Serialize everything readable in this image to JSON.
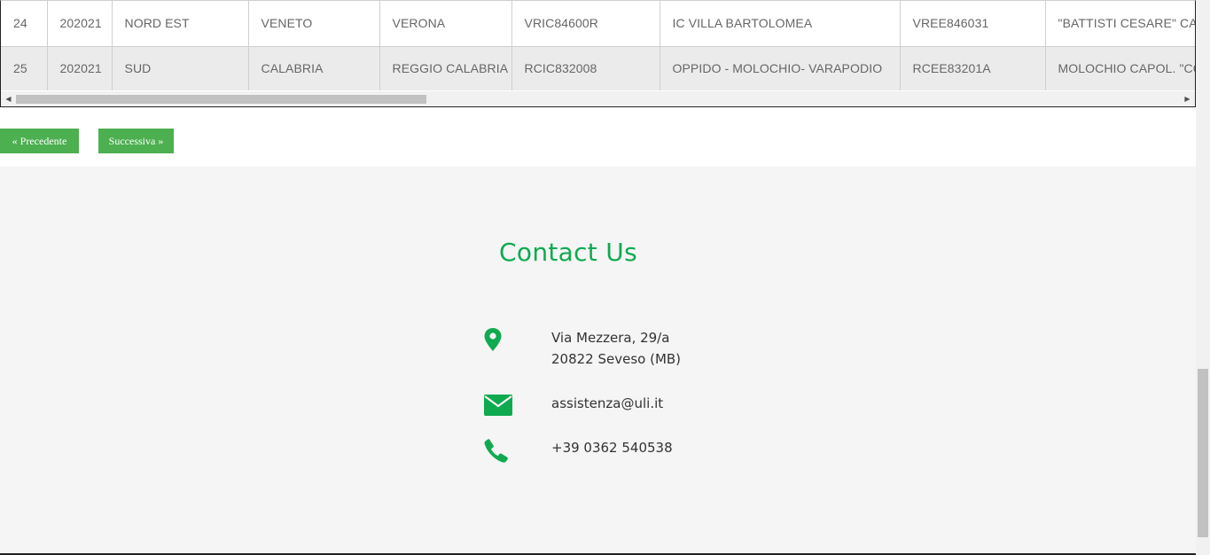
{
  "table": {
    "rows": [
      {
        "id": "24",
        "year": "202021",
        "area": "NORD EST",
        "region": "VENETO",
        "province": "VERONA",
        "school_code": "VRIC84600R",
        "school_name": "IC VILLA BARTOLOMEA",
        "plesso_code": "VREE846031",
        "plesso_name": "\"BATTISTI CESARE\" CAST"
      },
      {
        "id": "25",
        "year": "202021",
        "area": "SUD",
        "region": "CALABRIA",
        "province": "REGGIO CALABRIA",
        "school_code": "RCIC832008",
        "school_name": "OPPIDO - MOLOCHIO- VARAPODIO",
        "plesso_code": "RCEE83201A",
        "plesso_name": "MOLOCHIO CAPOL. \"CO"
      }
    ],
    "scroll_left_arrow": "◀",
    "scroll_right_arrow": "▶"
  },
  "pager": {
    "prev_label": "« Precedente",
    "next_label": "Successiva »"
  },
  "footer": {
    "title": "Contact Us",
    "address_line1": "Via Mezzera, 29/a",
    "address_line2": "20822 Seveso (MB)",
    "email": "assistenza@uli.it",
    "phone": "+39 0362 540538",
    "icons": {
      "address": "map-marker-icon",
      "email": "envelope-icon",
      "phone": "phone-icon"
    }
  },
  "colors": {
    "accent": "#0faa4f",
    "button": "#4caf50",
    "footer_bg": "#f5f5f5",
    "row_alt_bg": "#ebebeb"
  }
}
